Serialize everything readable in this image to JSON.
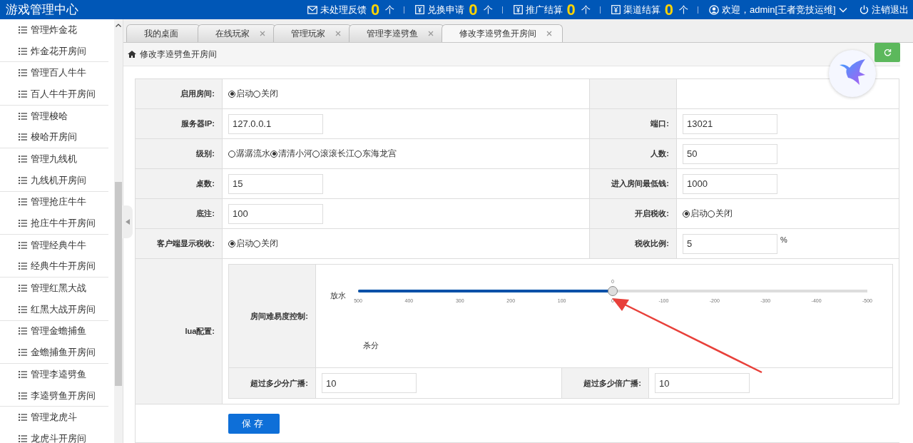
{
  "header": {
    "title": "游戏管理中心",
    "notices": [
      {
        "kind": "mail",
        "label": "未处理反馈",
        "count": "0",
        "unit": "个"
      },
      {
        "kind": "voucher",
        "label": "兑换申请",
        "count": "0",
        "unit": "个"
      },
      {
        "kind": "voucher",
        "label": "推广结算",
        "count": "0",
        "unit": "个"
      },
      {
        "kind": "voucher",
        "label": "渠道结算",
        "count": "0",
        "unit": "个"
      }
    ],
    "user": "欢迎，admin[王者竞技运维]",
    "logout": "注销退出"
  },
  "sidebar": {
    "groups": [
      [
        "管理炸金花",
        "炸金花开房间"
      ],
      [
        "管理百人牛牛",
        "百人牛牛开房间"
      ],
      [
        "管理梭哈",
        "梭哈开房间"
      ],
      [
        "管理九线机",
        "九线机开房间"
      ],
      [
        "管理抢庄牛牛",
        "抢庄牛牛开房间"
      ],
      [
        "管理经典牛牛",
        "经典牛牛开房间"
      ],
      [
        "管理红黑大战",
        "红黑大战开房间"
      ],
      [
        "管理金蟾捕鱼",
        "金蟾捕鱼开房间"
      ],
      [
        "管理李逵劈鱼",
        "李逵劈鱼开房间"
      ],
      [
        "管理龙虎斗",
        "龙虎斗开房间"
      ]
    ]
  },
  "tabs": [
    {
      "label": "我的桌面",
      "selected": false,
      "closable": false
    },
    {
      "label": "在线玩家",
      "selected": false,
      "closable": true
    },
    {
      "label": "管理玩家",
      "selected": false,
      "closable": true
    },
    {
      "label": "管理李逵劈鱼",
      "selected": false,
      "closable": true
    },
    {
      "label": "修改李逵劈鱼开房间",
      "selected": true,
      "closable": true
    }
  ],
  "breadcrumb": "修改李逵劈鱼开房间",
  "form": {
    "rows": [
      {
        "left": {
          "label": "启用房间:",
          "kind": "radio",
          "options": [
            {
              "label": "启动",
              "selected": true
            },
            {
              "label": "关闭",
              "selected": false
            }
          ]
        }
      },
      {
        "left": {
          "label": "服务器IP:",
          "kind": "input",
          "value": "127.0.0.1"
        },
        "right": {
          "label": "端口:",
          "kind": "input",
          "value": "13021"
        }
      },
      {
        "left": {
          "label": "级别:",
          "kind": "radio",
          "options": [
            {
              "label": "潺潺流水",
              "selected": false
            },
            {
              "label": "清清小河",
              "selected": true
            },
            {
              "label": "滚滚长江",
              "selected": false
            },
            {
              "label": "东海龙宫",
              "selected": false
            }
          ]
        },
        "right": {
          "label": "人数:",
          "kind": "input",
          "value": "50"
        }
      },
      {
        "left": {
          "label": "桌数:",
          "kind": "input",
          "value": "15"
        },
        "right": {
          "label": "进入房间最低钱:",
          "kind": "input",
          "value": "1000"
        }
      },
      {
        "left": {
          "label": "底注:",
          "kind": "input",
          "value": "100"
        },
        "right": {
          "label": "开启税收:",
          "kind": "radio",
          "options": [
            {
              "label": "启动",
              "selected": true
            },
            {
              "label": "关闭",
              "selected": false
            }
          ]
        }
      },
      {
        "left": {
          "label": "客户端显示税收:",
          "kind": "radio",
          "options": [
            {
              "label": "启动",
              "selected": true
            },
            {
              "label": "关闭",
              "selected": false
            }
          ]
        },
        "right": {
          "label": "税收比例:",
          "kind": "input",
          "value": "5",
          "suffix": "%"
        }
      }
    ],
    "lua": {
      "label": "lua配置:",
      "slider": {
        "label": "房间难易度控制:",
        "left_label": "放水",
        "right_label": "杀分",
        "reading": "0",
        "level": 0.5,
        "ticks": [
          "500",
          "400",
          "300",
          "200",
          "100",
          "0",
          "-100",
          "-200",
          "-300",
          "-400",
          "-500"
        ]
      },
      "broadcast": [
        {
          "label": "超过多少分广播:",
          "value": "10"
        },
        {
          "label": "超过多少倍广播:",
          "value": "10"
        }
      ]
    },
    "save": "保存"
  }
}
